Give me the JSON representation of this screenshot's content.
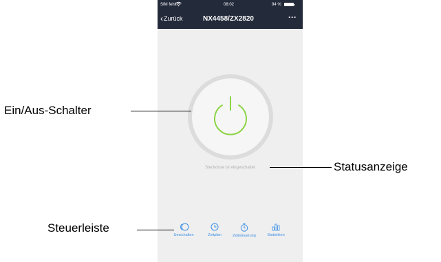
{
  "status_bar": {
    "carrier": "SIM fehlt",
    "time": "08:02",
    "battery": "94 %"
  },
  "nav_bar": {
    "back_label": "Zurück",
    "title": "NX4458/ZX2820",
    "more": "···"
  },
  "power": {
    "state": "on",
    "icon_color": "#8bd444",
    "status_text": "Steckdose ist eingeschaltet"
  },
  "toolbar": {
    "items": [
      {
        "label": "Umschalten",
        "icon": "toggle-icon"
      },
      {
        "label": "Zeitplan",
        "icon": "clock-icon"
      },
      {
        "label": "Zeitsteuerung",
        "icon": "stopwatch-icon"
      },
      {
        "label": "Statistiken",
        "icon": "bar-chart-icon"
      }
    ],
    "accent": "#3a8ee6"
  },
  "callouts": {
    "switch": "Ein/Aus-Schalter",
    "status": "Statusanzeige",
    "toolbar": "Steuerleiste"
  }
}
